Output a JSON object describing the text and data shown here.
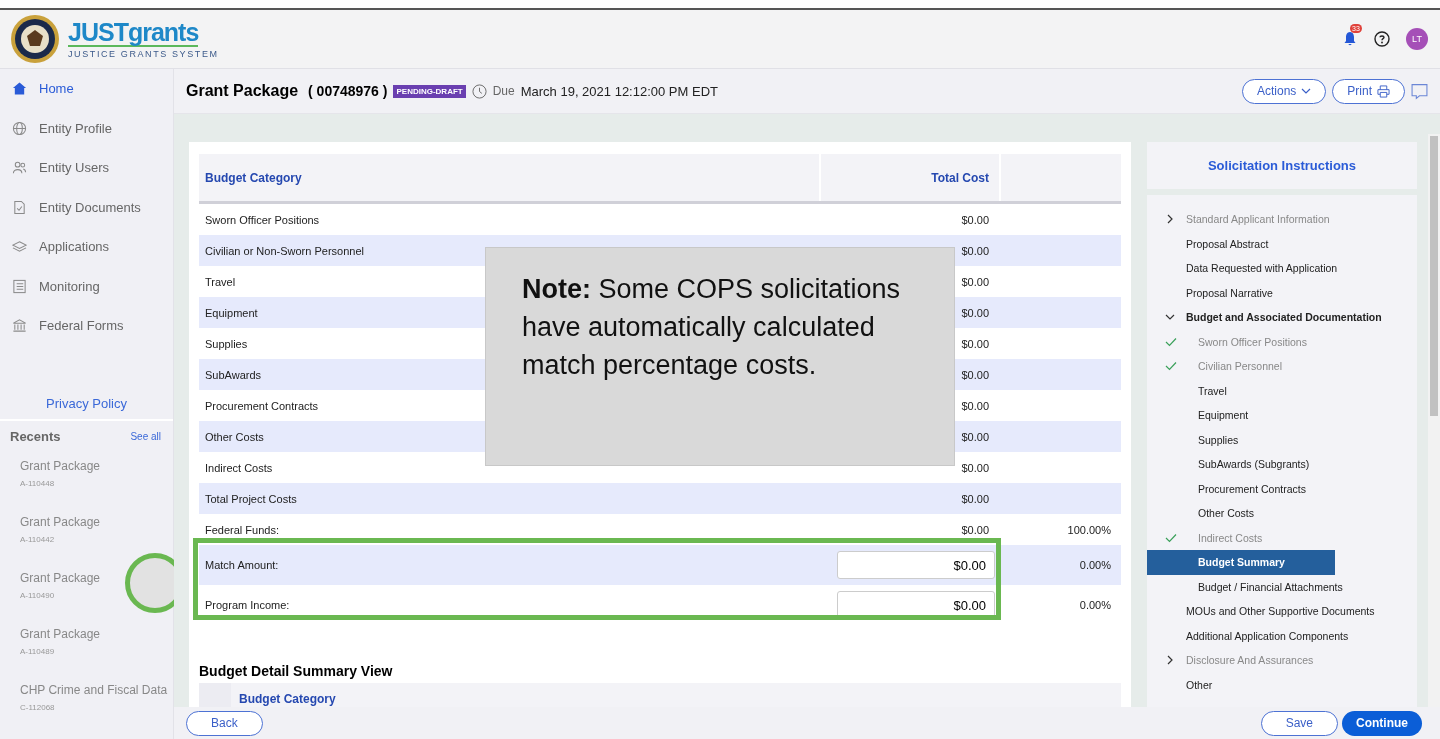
{
  "header": {
    "logo_text": "**JUST**grants",
    "logo_subtitle": "JUSTICE GRANTS SYSTEM",
    "notification_count": "33",
    "avatar_initials": "LT"
  },
  "sidebar": {
    "items": [
      {
        "label": "Home",
        "selected": true
      },
      {
        "label": "Entity Profile",
        "selected": false
      },
      {
        "label": "Entity Users",
        "selected": false
      },
      {
        "label": "Entity Documents",
        "selected": false
      },
      {
        "label": "Applications",
        "selected": false
      },
      {
        "label": "Monitoring",
        "selected": false
      },
      {
        "label": "Federal Forms",
        "selected": false
      }
    ],
    "privacy_link": "Privacy Policy",
    "recents_title": "Recents",
    "see_all": "See all",
    "recents": [
      {
        "title": "Grant Package",
        "id": "A-110448"
      },
      {
        "title": "Grant Package",
        "id": "A-110442"
      },
      {
        "title": "Grant Package",
        "id": "A-110490"
      },
      {
        "title": "Grant Package",
        "id": "A-110489"
      },
      {
        "title": "CHP Crime and Fiscal Data",
        "id": "C-112068"
      }
    ]
  },
  "title_bar": {
    "title": "Grant Package",
    "number": "( 00748976 )",
    "status": "PENDING-DRAFT",
    "due_label": "Due",
    "due_date": "March 19, 2021 12:12:00 PM EDT",
    "actions_button": "Actions",
    "print_button": "Print"
  },
  "budget_table": {
    "columns": [
      "Budget Category",
      "Total Cost"
    ],
    "rows": [
      {
        "kind": "text",
        "category": "Sworn Officer Positions",
        "cost": "$0.00"
      },
      {
        "kind": "text",
        "category": "Civilian or Non-Sworn Personnel",
        "cost": "$0.00"
      },
      {
        "kind": "text",
        "category": "Travel",
        "cost": "$0.00"
      },
      {
        "kind": "text",
        "category": "Equipment",
        "cost": "$0.00"
      },
      {
        "kind": "text",
        "category": "Supplies",
        "cost": "$0.00"
      },
      {
        "kind": "text",
        "category": "SubAwards",
        "cost": "$0.00"
      },
      {
        "kind": "text",
        "category": "Procurement Contracts",
        "cost": "$0.00"
      },
      {
        "kind": "text",
        "category": "Other Costs",
        "cost": "$0.00"
      },
      {
        "kind": "text",
        "category": "Indirect Costs",
        "cost": "$0.00"
      },
      {
        "kind": "text",
        "category": "Total Project Costs",
        "cost": "$0.00"
      },
      {
        "kind": "text",
        "category": "Federal Funds:",
        "cost": "$0.00",
        "percent": "100.00%"
      },
      {
        "kind": "input",
        "category": "Match Amount:",
        "cost": "$0.00",
        "percent": "0.00%"
      },
      {
        "kind": "input",
        "category": "Program Income:",
        "cost": "$0.00",
        "percent": "0.00%"
      }
    ]
  },
  "note": "**Note:** Some COPS solicitations have automatically calculated match percentage costs.",
  "detail_section": {
    "title": "Budget Detail Summary View",
    "column": "Budget Category"
  },
  "instructions": {
    "title": "Solicitation Instructions",
    "items": [
      {
        "label": "Standard Applicant Information",
        "expanded": false,
        "dimmed": true,
        "selected": false
      },
      {
        "label": "Proposal Abstract",
        "dimmed": false,
        "checked": false,
        "selected": false
      },
      {
        "label": "Data Requested with Application",
        "dimmed": false,
        "checked": false,
        "selected": false
      },
      {
        "label": "Proposal Narrative",
        "dimmed": false,
        "checked": false,
        "selected": false
      },
      {
        "label": "Budget and Associated Documentation",
        "expanded": true,
        "dimmed": false,
        "selected": false,
        "children": [
          {
            "label": "Sworn Officer Positions",
            "dimmed": true,
            "checked": true,
            "selected": false
          },
          {
            "label": "Civilian Personnel",
            "dimmed": true,
            "checked": true,
            "selected": false
          },
          {
            "label": "Travel",
            "dimmed": false,
            "checked": false,
            "selected": false
          },
          {
            "label": "Equipment",
            "dimmed": false,
            "checked": false,
            "selected": false
          },
          {
            "label": "Supplies",
            "dimmed": false,
            "checked": false,
            "selected": false
          },
          {
            "label": "SubAwards (Subgrants)",
            "dimmed": false,
            "checked": false,
            "selected": false
          },
          {
            "label": "Procurement Contracts",
            "dimmed": false,
            "checked": false,
            "selected": false
          },
          {
            "label": "Other Costs",
            "dimmed": false,
            "checked": false,
            "selected": false
          },
          {
            "label": "Indirect Costs",
            "dimmed": true,
            "checked": true,
            "selected": false
          },
          {
            "label": "Budget Summary",
            "dimmed": false,
            "checked": false,
            "selected": true
          },
          {
            "label": "Budget / Financial Attachments",
            "dimmed": false,
            "checked": false,
            "selected": false
          }
        ]
      },
      {
        "label": "MOUs and Other Supportive Documents",
        "dimmed": false,
        "checked": false,
        "selected": false
      },
      {
        "label": "Additional Application Components",
        "dimmed": false,
        "checked": false,
        "selected": false
      },
      {
        "label": "Disclosure And Assurances",
        "expanded": false,
        "dimmed": true,
        "selected": false
      },
      {
        "label": "Other",
        "dimmed": false,
        "checked": false,
        "selected": false
      }
    ]
  },
  "footer": {
    "back_button": "Back",
    "save_button": "Save",
    "continue_button": "Continue"
  }
}
